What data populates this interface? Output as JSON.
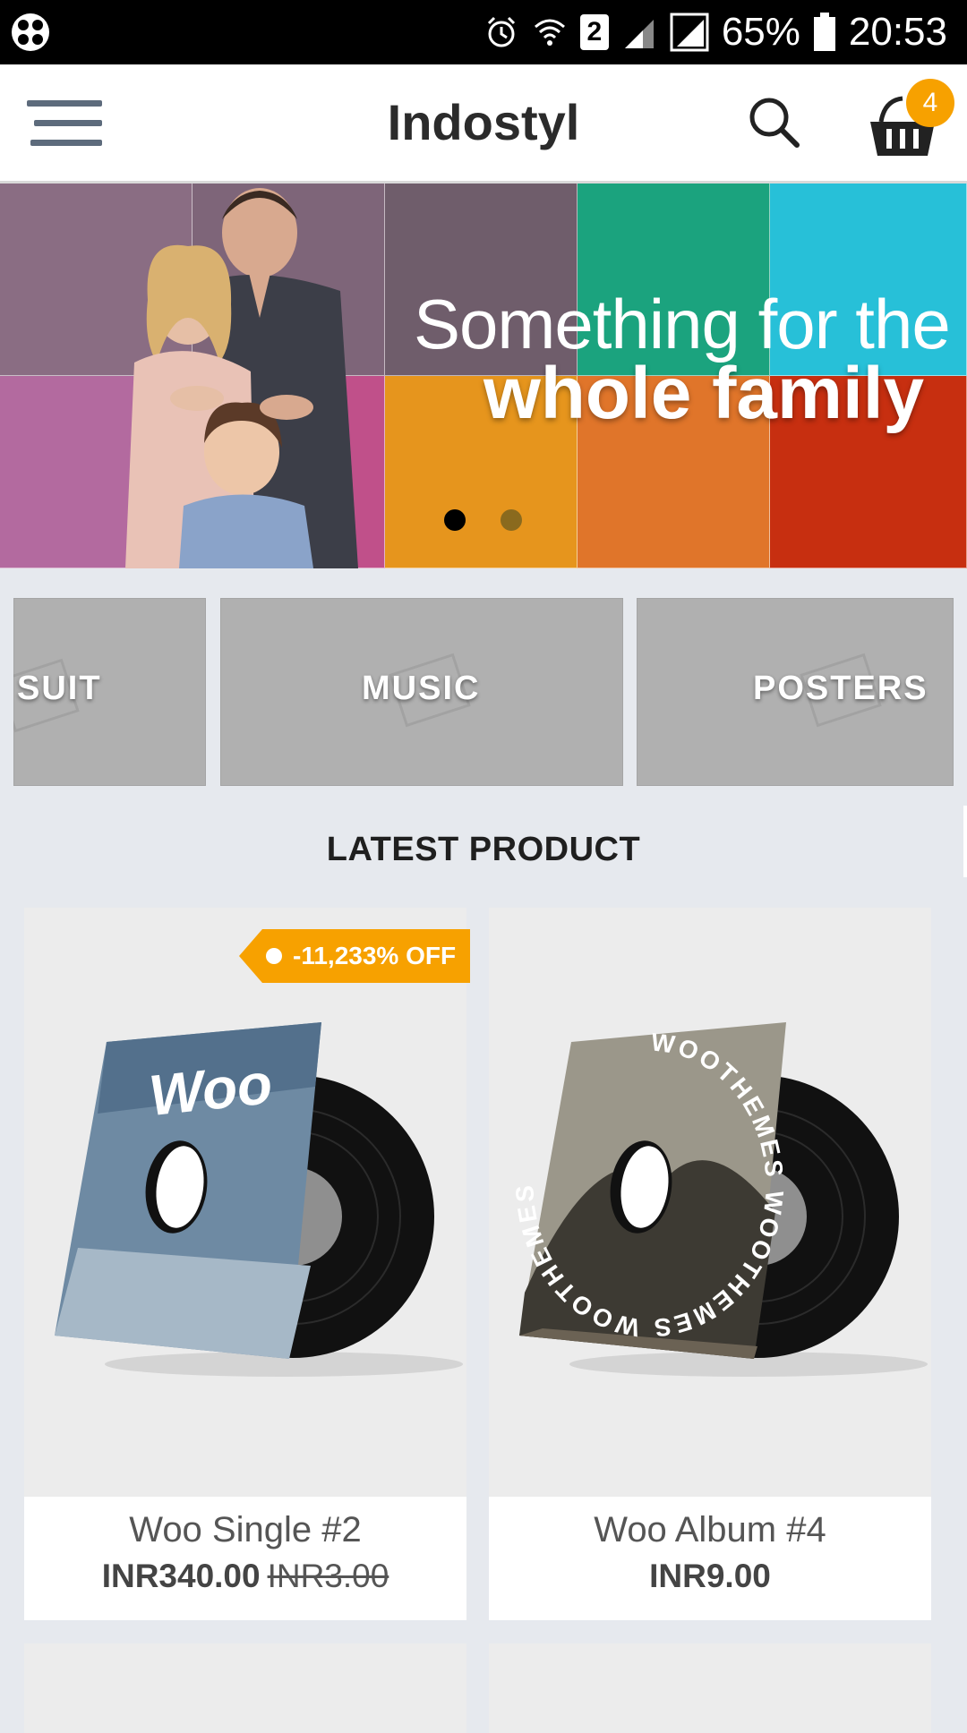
{
  "status_bar": {
    "battery": "65%",
    "time": "20:53",
    "sim_label": "2",
    "icons": [
      "app-icon",
      "alarm-icon",
      "wifi-icon",
      "sim-icon",
      "signal-icon",
      "signal-icon",
      "battery-icon"
    ]
  },
  "header": {
    "title": "Indostyl",
    "cart_count": "4",
    "icons": [
      "menu-icon",
      "search-icon",
      "basket-icon"
    ]
  },
  "banner": {
    "line1": "Something for the",
    "line2": "whole family",
    "slides": 2,
    "active_slide": 1,
    "tile_colors": [
      "#8a6d83",
      "#7e6579",
      "#6f5d6b",
      "#1ba37e",
      "#27c0d8",
      "#b36a9f",
      "#c0508a",
      "#e6951d",
      "#e0752a",
      "#c72f10"
    ]
  },
  "categories": [
    {
      "label": "SUIT"
    },
    {
      "label": "MUSIC"
    },
    {
      "label": "POSTERS"
    }
  ],
  "section": {
    "title": "LATEST PRODUCT"
  },
  "products": [
    {
      "name": "Woo Single #2",
      "price": "INR340.00",
      "old_price": "INR3.00",
      "badge": "-11,233% OFF",
      "cover_text": "Woo"
    },
    {
      "name": "Woo Album #4",
      "price": "INR9.00",
      "cover_text": "WOOTHEMES WOOTHEMES WOOTHEMES"
    }
  ],
  "colors": {
    "accent": "#f7a100",
    "header_bg": "#ffffff",
    "page_bg": "#e6e9ee"
  }
}
